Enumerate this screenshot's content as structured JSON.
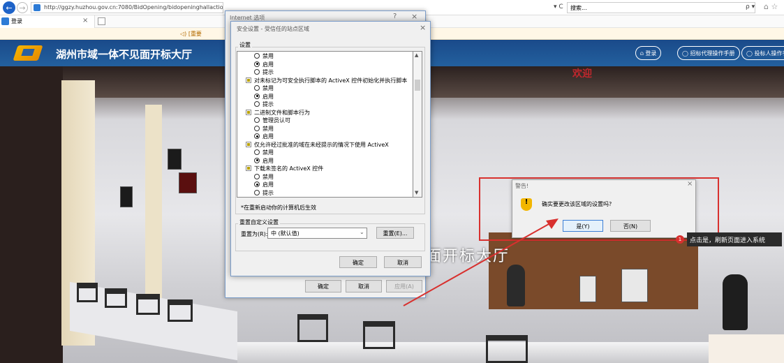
{
  "browser": {
    "url": "http://ggzy.huzhou.gov.cn:7080/BidOpening/bidopeninghallaction/hall/lo",
    "refresh_label": "▾ C",
    "search_placeholder": "搜索...",
    "search_icon": "ρ ▾",
    "tab_title": "登录",
    "notice_text": "◁) [重要"
  },
  "site": {
    "title": "湖州市域一体不见面开标大厅",
    "buttons": [
      "登录",
      "招标代理操作手册",
      "投标人操作手"
    ],
    "scene_title": "面开标大厅",
    "scene_sign": "欢迎"
  },
  "ie_dialog": {
    "title": "Internet 选项",
    "help": "?",
    "close": "×",
    "buttons": {
      "ok": "确定",
      "cancel": "取消",
      "apply": "应用(A)"
    }
  },
  "security_dialog": {
    "title": "安全设置 - 受信任的站点区域",
    "close": "×",
    "settings_label": "设置",
    "settings": [
      {
        "type": "radio",
        "label": "禁用",
        "checked": false
      },
      {
        "type": "radio",
        "label": "启用",
        "checked": true
      },
      {
        "type": "radio",
        "label": "提示",
        "checked": false
      },
      {
        "type": "category",
        "label": "对未标记为可安全执行脚本的 ActiveX 控件初始化并执行脚本"
      },
      {
        "type": "radio",
        "label": "禁用",
        "checked": false
      },
      {
        "type": "radio",
        "label": "启用",
        "checked": true
      },
      {
        "type": "radio",
        "label": "提示",
        "checked": false
      },
      {
        "type": "category",
        "label": "二进制文件和脚本行为"
      },
      {
        "type": "radio",
        "label": "管理员认可",
        "checked": false
      },
      {
        "type": "radio",
        "label": "禁用",
        "checked": false
      },
      {
        "type": "radio",
        "label": "启用",
        "checked": true
      },
      {
        "type": "category",
        "label": "仅允许经过批准的域在未经提示的情况下使用 ActiveX"
      },
      {
        "type": "radio",
        "label": "禁用",
        "checked": false
      },
      {
        "type": "radio",
        "label": "启用",
        "checked": true
      },
      {
        "type": "category",
        "label": "下载未签名的 ActiveX 控件"
      },
      {
        "type": "radio",
        "label": "禁用",
        "checked": false
      },
      {
        "type": "radio",
        "label": "启用",
        "checked": true
      },
      {
        "type": "radio",
        "label": "提示",
        "checked": false
      }
    ],
    "restart_note": "*在重新启动你的计算机后生效",
    "reset_group_label": "重置自定义设置",
    "reset_to_label": "重置为(R):",
    "reset_value": "中 (默认值)",
    "reset_button": "重置(E)...",
    "ok": "确定",
    "cancel": "取消"
  },
  "warning_dialog": {
    "title": "警告!",
    "close": "×",
    "message": "确实要更改该区域的设置吗?",
    "yes": "是(Y)",
    "no": "否(N)"
  },
  "annotation": {
    "step": "1",
    "text": "点击是，刷新页面进入系统",
    "color": "#d8302e"
  }
}
